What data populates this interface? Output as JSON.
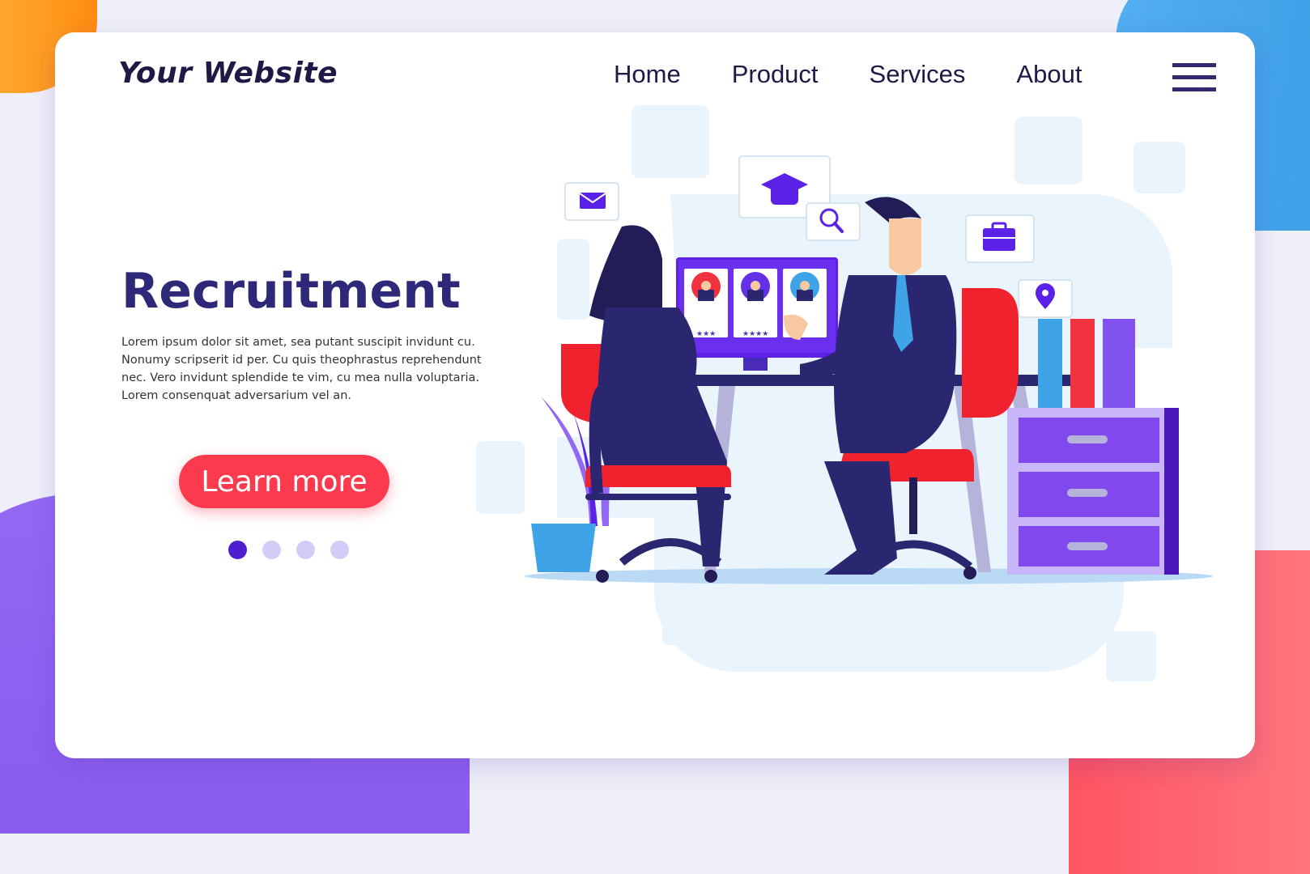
{
  "header": {
    "logo": "Your Website",
    "nav": [
      "Home",
      "Product",
      "Services",
      "About"
    ],
    "menu_icon": "hamburger-icon"
  },
  "hero": {
    "title": "Recruitment",
    "description": "Lorem ipsum dolor sit amet, sea putant suscipit invidunt cu. Nonumy scripserit id per. Cu quis theophrastus reprehendunt nec. Vero invidunt splendide te vim, cu mea nulla voluptaria. Lorem consenquat adversarium vel an.",
    "cta_label": "Learn more",
    "carousel": {
      "total": 4,
      "active": 1
    }
  },
  "illustration": {
    "subject": "recruitment-interview",
    "floating_icons": [
      "mail-icon",
      "graduation-cap-icon",
      "search-icon",
      "briefcase-icon",
      "location-pin-icon"
    ],
    "candidate_cards": [
      {
        "avatar": "woman-avatar",
        "rating": 3,
        "rating_text": "★★★"
      },
      {
        "avatar": "man-avatar",
        "rating": 4,
        "rating_text": "★★★★"
      },
      {
        "avatar": "bearded-man-avatar",
        "rating": null,
        "rating_text": ""
      }
    ]
  },
  "colors": {
    "primary_dark": "#2e2878",
    "accent_red": "#fc3a4e",
    "accent_purple": "#5b21e6",
    "dot_inactive": "#d4ccf8",
    "dot_active": "#4d1fcf"
  }
}
